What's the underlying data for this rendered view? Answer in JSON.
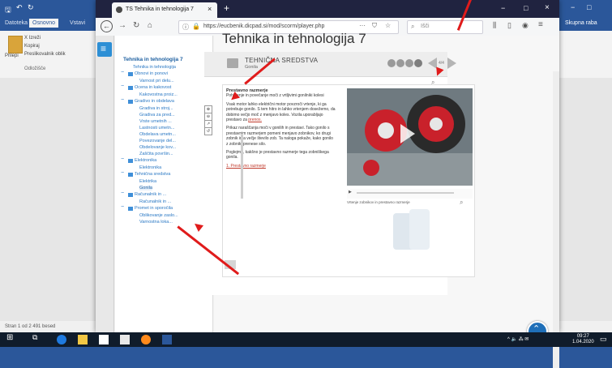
{
  "word": {
    "tabs": [
      "Datoteka",
      "Osnovno",
      "Vstavi"
    ],
    "ribbon": {
      "paste_label": "Prilepi",
      "clipboard_label": "Odložišče",
      "cut_label": "X Izreži",
      "copy_label": "Kopiraj",
      "format_painter_label": "Preslikovalnik oblik",
      "share_label": "Skupna raba"
    },
    "status_left": "Stran 1 od 2   491 besed"
  },
  "firefox": {
    "tab_title": "TS Tehnika in tehnologija 7",
    "url": "https://eucbenik.dicpad.si/mod/scorm/player.php",
    "search_placeholder": "Išči"
  },
  "toc": {
    "title": "Tehnika in tehnologija 7",
    "items": [
      {
        "label": "Tehnika in tehnologija",
        "indent": 2,
        "box": false
      },
      {
        "label": "Obnovi in ponovi",
        "indent": 1,
        "box": true
      },
      {
        "label": "Varnost pri delu...",
        "indent": 3,
        "box": false
      },
      {
        "label": "Ocena in kakovost",
        "indent": 1,
        "box": true
      },
      {
        "label": "Kakovostna proiz...",
        "indent": 3,
        "box": false
      },
      {
        "label": "Gradivo in obdelava",
        "indent": 1,
        "box": true
      },
      {
        "label": "Gradiva in stroj...",
        "indent": 3,
        "box": false
      },
      {
        "label": "Gradiva za pred...",
        "indent": 3,
        "box": false
      },
      {
        "label": "Vrste umetnih ...",
        "indent": 3,
        "box": false
      },
      {
        "label": "Lastnosti umetn...",
        "indent": 3,
        "box": false
      },
      {
        "label": "Obdelava umetn...",
        "indent": 3,
        "box": false
      },
      {
        "label": "Povezovanje del...",
        "indent": 3,
        "box": false
      },
      {
        "label": "Obdelovanje kov...",
        "indent": 3,
        "box": false
      },
      {
        "label": "Zaščita površin...",
        "indent": 3,
        "box": false
      },
      {
        "label": "Elektronika",
        "indent": 1,
        "box": true
      },
      {
        "label": "Elektronika",
        "indent": 3,
        "box": false
      },
      {
        "label": "Tehnična sredstva",
        "indent": 1,
        "box": true
      },
      {
        "label": "Elektrika",
        "indent": 3,
        "box": false
      },
      {
        "label": "Gonila",
        "indent": 3,
        "box": false,
        "selected": true
      },
      {
        "label": "Računalnik in ...",
        "indent": 1,
        "box": true
      },
      {
        "label": "Računalnik in ...",
        "indent": 3,
        "box": false
      },
      {
        "label": "Promet in sporočila",
        "indent": 1,
        "box": true
      },
      {
        "label": "Oblikovanje zaslo...",
        "indent": 3,
        "box": false
      },
      {
        "label": "Varnostna loka...",
        "indent": 3,
        "box": false
      }
    ]
  },
  "content": {
    "page_heading": "Tehnika in tehnologija 7",
    "player_title": "TEHNIČNA SREDSTVA",
    "player_subtitle": "Gonila",
    "page_counter": "4/4",
    "slide": {
      "heading": "Prestavno razmerje",
      "intro": "Pohitrenje in povečanje moči z vrtljivimi gonilniki kolesi",
      "para1": "Vsak motor lahko električni motor povzroči vrtenje, ki ga potrebuje gonilo. S tem hitro in lahko vrtenjem dosežemo, da dobimo večjo moč z menjavo koles. Vozila uporabljajo prestavo za",
      "para1_link": "prenos.",
      "para2": "Prikaz naraščanja moči v gonilih in prestavi. Tako gonilo s prestavnim razmerjem pomeni menjavo zobnikov, ko drugi zobnik ima večje število zob. Ta naloga pokaže, kako gonilo z zobniki prenese silo.",
      "para3": "Poglejmo, kakšno je prestavno razmerje tega zobniškega gonila.",
      "link": "1. Prestavno razmerje",
      "video_caption": "Vrtenje zobnikov in prestavno razmerje",
      "tools": [
        "⊕",
        "⊖",
        "↗",
        "↺"
      ]
    }
  },
  "taskbar": {
    "time": "09:27",
    "date": "1.04.2020"
  },
  "colors": {
    "word_blue": "#2b579a",
    "link_blue": "#2a78c4",
    "annotation_red": "#e01b1b",
    "taskbar": "#101c2b"
  }
}
